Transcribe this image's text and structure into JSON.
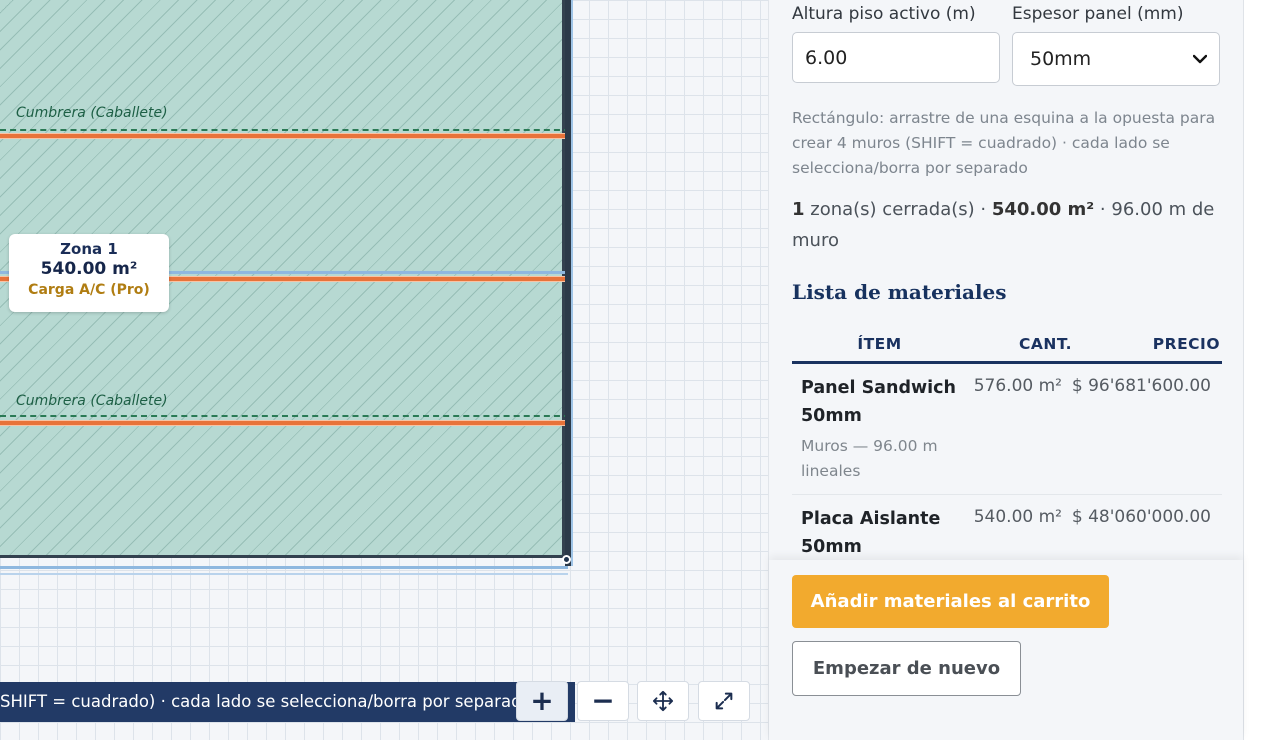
{
  "canvas": {
    "ridge_label": "Cumbrera (Caballete)",
    "zone": {
      "name": "Zona 1",
      "area": "540.00 m²",
      "load": "Carga A/C (Pro)"
    },
    "tip_text": "SHIFT = cuadrado) · cada lado se selecciona/borra por separado",
    "controls": {
      "zoom_in": "+",
      "zoom_out": "−"
    }
  },
  "panel": {
    "height_label": "Altura piso activo (m)",
    "height_value": "6.00",
    "thickness_label": "Espesor panel (mm)",
    "thickness_value": "50mm",
    "help_text": "Rectángulo: arrastre de una esquina a la opuesta para crear 4 muros (SHIFT = cuadrado) · cada lado se selecciona/borra por separado",
    "summary": {
      "zones_count": "1",
      "zones_text": " zona(s) cerrada(s) · ",
      "area": "540.00 m²",
      "walls_text": " · 96.00 m de muro"
    },
    "materials_title": "Lista de materiales",
    "table": {
      "headers": {
        "item": "ÍTEM",
        "qty": "CANT.",
        "price": "PRECIO"
      },
      "rows": [
        {
          "name": "Panel Sandwich 50mm",
          "sub": "Muros — 96.00 m lineales",
          "qty": "576.00 m²",
          "price": "$ 96'681'600.00"
        },
        {
          "name": "Placa Aislante 50mm",
          "sub": "",
          "qty": "540.00 m²",
          "price": "$ 48'060'000.00"
        }
      ]
    },
    "add_button": "Añadir materiales al carrito",
    "reset_button": "Empezar de nuevo"
  },
  "colors": {
    "accent_orange": "#f2aa2e",
    "navy": "#1a3260",
    "zone_fill": "#b7d9d2"
  }
}
